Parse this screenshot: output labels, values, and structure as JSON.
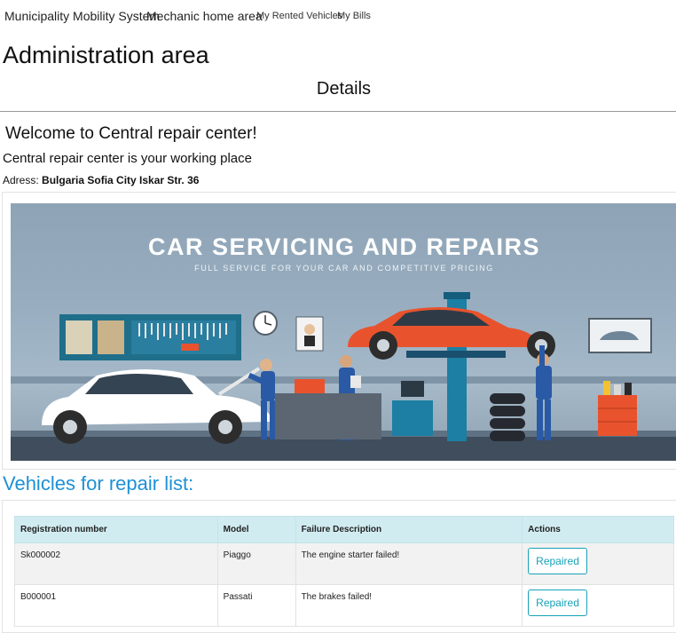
{
  "nav": {
    "brand": "Municipality Mobility System",
    "section": "Mechanic home area",
    "links": [
      "My Rented Vehicles",
      "My Bills"
    ]
  },
  "page": {
    "admin_title": "Administration area",
    "details_title": "Details",
    "welcome": "Welcome to Central repair center!",
    "workplace": "Central repair center is your working place",
    "address_label": "Adress:",
    "address_value": "Bulgaria Sofia City Iskar Str. 36"
  },
  "banner": {
    "title": "CAR SERVICING AND REPAIRS",
    "subtitle": "FULL SERVICE FOR YOUR CAR AND COMPETITIVE PRICING"
  },
  "repairs": {
    "title": "Vehicles for repair list:",
    "columns": [
      "Registration number",
      "Model",
      "Failure Description",
      "Actions"
    ],
    "rows": [
      {
        "registration": "Sk000002",
        "model": "Piaggo",
        "failure": "The engine starter failed!",
        "action": "Repaired"
      },
      {
        "registration": "B000001",
        "model": "Passati",
        "failure": "The brakes failed!",
        "action": "Repaired"
      }
    ]
  },
  "colors": {
    "accent_blue": "#1e90d6",
    "table_header": "#d1ecf1",
    "button_info": "#17a2b8",
    "car_red": "#e8532d",
    "lift_blue": "#1c7fa3"
  }
}
